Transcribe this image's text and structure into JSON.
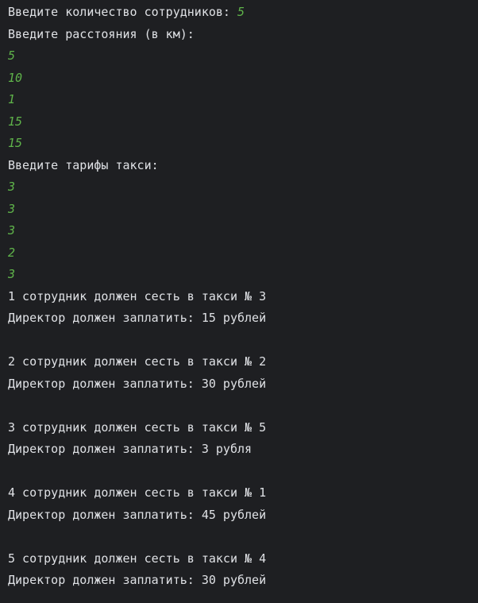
{
  "colors": {
    "background": "#1e1f22",
    "output_text": "#dfe1e5",
    "user_input": "#5fb34a"
  },
  "console": {
    "prompt_count": "Введите количество сотрудников: ",
    "count_input": "5",
    "prompt_distances": "Введите расстояния (в км):",
    "distances": [
      "5",
      "10",
      "1",
      "15",
      "15"
    ],
    "prompt_tariffs": "Введите тарифы такси:",
    "tariffs": [
      "3",
      "3",
      "3",
      "2",
      "3"
    ],
    "results": [
      {
        "assign": "1 сотрудник должен сесть в такси № 3",
        "pay": "Директор должен заплатить: 15 рублей"
      },
      {
        "assign": "2 сотрудник должен сесть в такси № 2",
        "pay": "Директор должен заплатить: 30 рублей"
      },
      {
        "assign": "3 сотрудник должен сесть в такси № 5",
        "pay": "Директор должен заплатить: 3 рубля"
      },
      {
        "assign": "4 сотрудник должен сесть в такси № 1",
        "pay": "Директор должен заплатить: 45 рублей"
      },
      {
        "assign": "5 сотрудник должен сесть в такси № 4",
        "pay": "Директор должен заплатить: 30 рублей"
      }
    ]
  }
}
